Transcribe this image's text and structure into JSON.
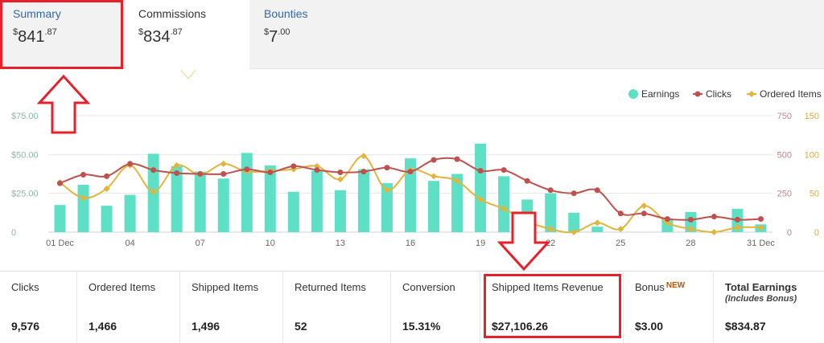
{
  "tabs": [
    {
      "label": "Summary",
      "currency": "$",
      "whole": "841",
      "cents": ".87"
    },
    {
      "label": "Commissions",
      "currency": "$",
      "whole": "834",
      "cents": ".87"
    },
    {
      "label": "Bounties",
      "currency": "$",
      "whole": "7",
      "cents": ".00"
    }
  ],
  "legend": [
    {
      "label": "Earnings"
    },
    {
      "label": "Clicks"
    },
    {
      "label": "Ordered Items"
    }
  ],
  "chart_data": {
    "type": "bar",
    "x": [
      "01 Dec",
      "02",
      "03",
      "04",
      "05",
      "06",
      "07",
      "08",
      "09",
      "10",
      "11",
      "12",
      "13",
      "14",
      "15",
      "16",
      "17",
      "18",
      "19",
      "20",
      "21",
      "22",
      "23",
      "24",
      "25",
      "26",
      "27",
      "28",
      "29",
      "30",
      "31 Dec"
    ],
    "x_tick_labels": [
      "01 Dec",
      "04",
      "07",
      "10",
      "13",
      "16",
      "19",
      "22",
      "25",
      "28",
      "31 Dec"
    ],
    "series": [
      {
        "name": "Earnings",
        "type": "bar",
        "axis": "left",
        "color": "#5ee0c6",
        "values": [
          17.5,
          30.5,
          17,
          24,
          50.5,
          42.5,
          39,
          34.5,
          51,
          43,
          26,
          39.5,
          27,
          40.5,
          31.5,
          47.5,
          33,
          37.5,
          57,
          36,
          21,
          25,
          12.5,
          3.5,
          0,
          0,
          8,
          13,
          0,
          15,
          5
        ]
      },
      {
        "name": "Clicks",
        "type": "line",
        "axis": "right",
        "color": "#c0504d",
        "values": [
          315,
          370,
          360,
          440,
          400,
          380,
          375,
          375,
          405,
          385,
          425,
          400,
          385,
          390,
          415,
          390,
          465,
          470,
          395,
          400,
          330,
          270,
          250,
          270,
          120,
          120,
          85,
          80,
          100,
          80,
          85
        ]
      },
      {
        "name": "Ordered Items",
        "type": "line",
        "axis": "right2",
        "color": "#e3b43a",
        "values": [
          320,
          220,
          280,
          430,
          260,
          430,
          370,
          440,
          390,
          395,
          405,
          425,
          340,
          490,
          270,
          400,
          360,
          330,
          210,
          150,
          70,
          20,
          0,
          60,
          20,
          170,
          60,
          20,
          0,
          30,
          30
        ]
      }
    ],
    "left_axis": {
      "ylim": [
        0,
        75
      ],
      "ticks": [
        "0",
        "$25.00",
        "$50.00",
        "$75.00"
      ]
    },
    "right_axis": {
      "ylim": [
        0,
        750
      ],
      "ticks": [
        "0",
        "250",
        "500",
        "750"
      ]
    },
    "right_axis2": {
      "ylim": [
        0,
        150
      ],
      "ticks": [
        "0",
        "50",
        "100",
        "150"
      ]
    },
    "grid": true,
    "legend_position": "top-right"
  },
  "stats": [
    {
      "label": "Clicks",
      "value": "9,576"
    },
    {
      "label": "Ordered Items",
      "value": "1,466"
    },
    {
      "label": "Shipped Items",
      "value": "1,496"
    },
    {
      "label": "Returned Items",
      "value": "52"
    },
    {
      "label": "Conversion",
      "value": "15.31%"
    },
    {
      "label": "Shipped Items Revenue",
      "value": "$27,106.26"
    },
    {
      "label": "Bonus",
      "badge": "NEW",
      "value": "$3.00"
    },
    {
      "label": "Total Earnings",
      "sub_label": "(Includes Bonus)",
      "value": "$834.87"
    }
  ],
  "colors": {
    "earnings": "#5ee0c6",
    "clicks": "#c0504d",
    "ordered_items": "#e3b43a",
    "annotation": "#e8202a",
    "link": "#3366a8"
  }
}
